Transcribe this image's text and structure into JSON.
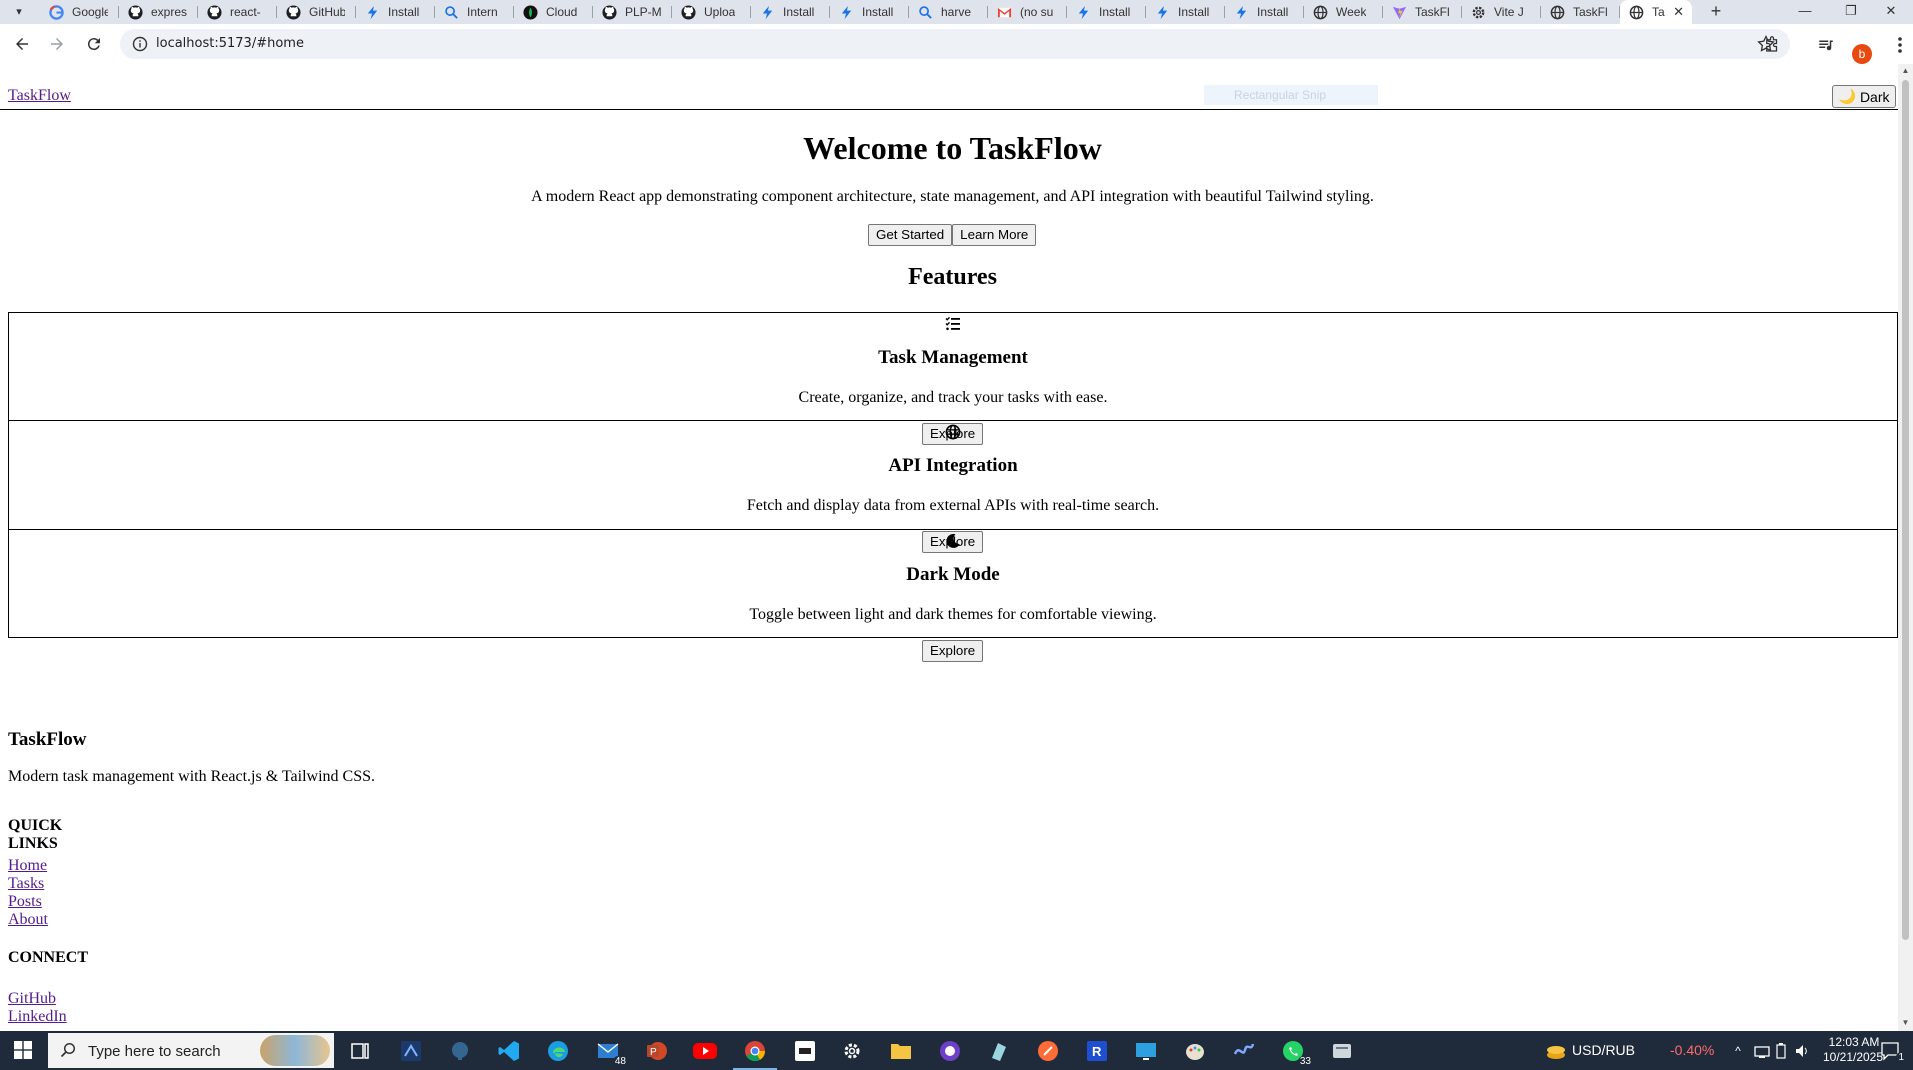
{
  "browser": {
    "tabs": [
      {
        "title": "Google",
        "icon": "google-icon"
      },
      {
        "title": "express",
        "icon": "github-icon"
      },
      {
        "title": "react-",
        "icon": "github-icon"
      },
      {
        "title": "GitHub",
        "icon": "github-icon"
      },
      {
        "title": "Install",
        "icon": "bolt-icon"
      },
      {
        "title": "Intern",
        "icon": "search-icon"
      },
      {
        "title": "Cloud",
        "icon": "cloud-icon"
      },
      {
        "title": "PLP-M",
        "icon": "github-icon"
      },
      {
        "title": "Uploa",
        "icon": "github-icon"
      },
      {
        "title": "Install",
        "icon": "bolt-icon"
      },
      {
        "title": "Install",
        "icon": "bolt-icon"
      },
      {
        "title": "harve",
        "icon": "search-icon"
      },
      {
        "title": "(no su",
        "icon": "gmail-icon"
      },
      {
        "title": "Install",
        "icon": "bolt-icon"
      },
      {
        "title": "Install",
        "icon": "bolt-icon"
      },
      {
        "title": "Install",
        "icon": "bolt-icon"
      },
      {
        "title": "Week",
        "icon": "globe-icon"
      },
      {
        "title": "TaskFl",
        "icon": "vite-icon"
      },
      {
        "title": "Vite J",
        "icon": "settings-icon"
      },
      {
        "title": "TaskFl",
        "icon": "globe-icon"
      }
    ],
    "active_tab": {
      "title": "Ta",
      "icon": "globe-icon",
      "close": "✕"
    },
    "new_tab": "+",
    "window": {
      "minimize": "—",
      "restore": "❐",
      "close": "✕"
    },
    "url": "localhost:5173/#home",
    "profile_initial": "b"
  },
  "page": {
    "brand": "TaskFlow",
    "snip_ghost": "Rectangular Snip",
    "dark_toggle": {
      "icon": "🌙",
      "label": "Dark"
    },
    "hero": {
      "title": "Welcome to TaskFlow",
      "subtitle": "A modern React app demonstrating component architecture, state management, and API integration with beautiful Tailwind styling.",
      "primary_label": "Get Started",
      "secondary_label": "Learn More"
    },
    "features_title": "Features",
    "features": [
      {
        "icon": "task-list-icon",
        "title": "Task Management",
        "desc": "Create, organize, and track your tasks with ease.",
        "button": "Explore"
      },
      {
        "icon": "globe-icon",
        "title": "API Integration",
        "desc": "Fetch and display data from external APIs with real-time search.",
        "button": "Explore"
      },
      {
        "icon": "moon-icon",
        "title": "Dark Mode",
        "desc": "Toggle between light and dark themes for comfortable viewing.",
        "button": "Explore"
      }
    ],
    "footer": {
      "brand": "TaskFlow",
      "tagline": "Modern task management with React.js & Tailwind CSS.",
      "quick_links_title": "QUICK LINKS",
      "quick_links": [
        "Home",
        "Tasks",
        "Posts",
        "About"
      ],
      "connect_title": "CONNECT",
      "connect_links": [
        "GitHub",
        "LinkedIn"
      ]
    }
  },
  "taskbar": {
    "search_placeholder": "Type here to search",
    "mail_badge": "48",
    "whatsapp_badge": "33",
    "currency": "USD/RUB",
    "currency_change": "-0.40%",
    "time": "12:03 AM",
    "date": "10/21/2025",
    "notifications": "1"
  },
  "colors": {
    "link_visited": "#551a8b",
    "tabbar_bg": "#dfe3eb",
    "taskbar_bg": "#1f2b3a",
    "negative": "#ff6b6b"
  }
}
